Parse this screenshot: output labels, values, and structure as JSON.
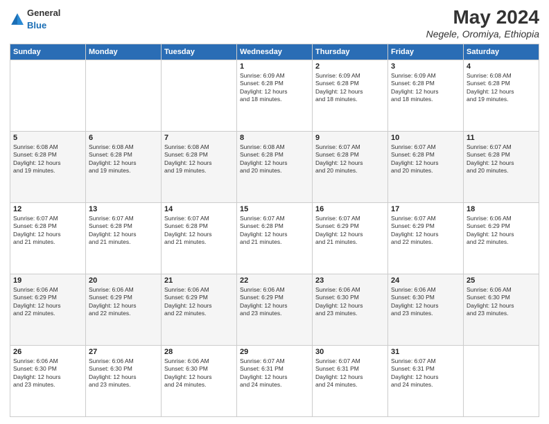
{
  "header": {
    "logo_general": "General",
    "logo_blue": "Blue",
    "month_year": "May 2024",
    "location": "Negele, Oromiya, Ethiopia"
  },
  "weekdays": [
    "Sunday",
    "Monday",
    "Tuesday",
    "Wednesday",
    "Thursday",
    "Friday",
    "Saturday"
  ],
  "weeks": [
    [
      {
        "day": "",
        "info": ""
      },
      {
        "day": "",
        "info": ""
      },
      {
        "day": "",
        "info": ""
      },
      {
        "day": "1",
        "info": "Sunrise: 6:09 AM\nSunset: 6:28 PM\nDaylight: 12 hours\nand 18 minutes."
      },
      {
        "day": "2",
        "info": "Sunrise: 6:09 AM\nSunset: 6:28 PM\nDaylight: 12 hours\nand 18 minutes."
      },
      {
        "day": "3",
        "info": "Sunrise: 6:09 AM\nSunset: 6:28 PM\nDaylight: 12 hours\nand 18 minutes."
      },
      {
        "day": "4",
        "info": "Sunrise: 6:08 AM\nSunset: 6:28 PM\nDaylight: 12 hours\nand 19 minutes."
      }
    ],
    [
      {
        "day": "5",
        "info": "Sunrise: 6:08 AM\nSunset: 6:28 PM\nDaylight: 12 hours\nand 19 minutes."
      },
      {
        "day": "6",
        "info": "Sunrise: 6:08 AM\nSunset: 6:28 PM\nDaylight: 12 hours\nand 19 minutes."
      },
      {
        "day": "7",
        "info": "Sunrise: 6:08 AM\nSunset: 6:28 PM\nDaylight: 12 hours\nand 19 minutes."
      },
      {
        "day": "8",
        "info": "Sunrise: 6:08 AM\nSunset: 6:28 PM\nDaylight: 12 hours\nand 20 minutes."
      },
      {
        "day": "9",
        "info": "Sunrise: 6:07 AM\nSunset: 6:28 PM\nDaylight: 12 hours\nand 20 minutes."
      },
      {
        "day": "10",
        "info": "Sunrise: 6:07 AM\nSunset: 6:28 PM\nDaylight: 12 hours\nand 20 minutes."
      },
      {
        "day": "11",
        "info": "Sunrise: 6:07 AM\nSunset: 6:28 PM\nDaylight: 12 hours\nand 20 minutes."
      }
    ],
    [
      {
        "day": "12",
        "info": "Sunrise: 6:07 AM\nSunset: 6:28 PM\nDaylight: 12 hours\nand 21 minutes."
      },
      {
        "day": "13",
        "info": "Sunrise: 6:07 AM\nSunset: 6:28 PM\nDaylight: 12 hours\nand 21 minutes."
      },
      {
        "day": "14",
        "info": "Sunrise: 6:07 AM\nSunset: 6:28 PM\nDaylight: 12 hours\nand 21 minutes."
      },
      {
        "day": "15",
        "info": "Sunrise: 6:07 AM\nSunset: 6:28 PM\nDaylight: 12 hours\nand 21 minutes."
      },
      {
        "day": "16",
        "info": "Sunrise: 6:07 AM\nSunset: 6:29 PM\nDaylight: 12 hours\nand 21 minutes."
      },
      {
        "day": "17",
        "info": "Sunrise: 6:07 AM\nSunset: 6:29 PM\nDaylight: 12 hours\nand 22 minutes."
      },
      {
        "day": "18",
        "info": "Sunrise: 6:06 AM\nSunset: 6:29 PM\nDaylight: 12 hours\nand 22 minutes."
      }
    ],
    [
      {
        "day": "19",
        "info": "Sunrise: 6:06 AM\nSunset: 6:29 PM\nDaylight: 12 hours\nand 22 minutes."
      },
      {
        "day": "20",
        "info": "Sunrise: 6:06 AM\nSunset: 6:29 PM\nDaylight: 12 hours\nand 22 minutes."
      },
      {
        "day": "21",
        "info": "Sunrise: 6:06 AM\nSunset: 6:29 PM\nDaylight: 12 hours\nand 22 minutes."
      },
      {
        "day": "22",
        "info": "Sunrise: 6:06 AM\nSunset: 6:29 PM\nDaylight: 12 hours\nand 23 minutes."
      },
      {
        "day": "23",
        "info": "Sunrise: 6:06 AM\nSunset: 6:30 PM\nDaylight: 12 hours\nand 23 minutes."
      },
      {
        "day": "24",
        "info": "Sunrise: 6:06 AM\nSunset: 6:30 PM\nDaylight: 12 hours\nand 23 minutes."
      },
      {
        "day": "25",
        "info": "Sunrise: 6:06 AM\nSunset: 6:30 PM\nDaylight: 12 hours\nand 23 minutes."
      }
    ],
    [
      {
        "day": "26",
        "info": "Sunrise: 6:06 AM\nSunset: 6:30 PM\nDaylight: 12 hours\nand 23 minutes."
      },
      {
        "day": "27",
        "info": "Sunrise: 6:06 AM\nSunset: 6:30 PM\nDaylight: 12 hours\nand 23 minutes."
      },
      {
        "day": "28",
        "info": "Sunrise: 6:06 AM\nSunset: 6:30 PM\nDaylight: 12 hours\nand 24 minutes."
      },
      {
        "day": "29",
        "info": "Sunrise: 6:07 AM\nSunset: 6:31 PM\nDaylight: 12 hours\nand 24 minutes."
      },
      {
        "day": "30",
        "info": "Sunrise: 6:07 AM\nSunset: 6:31 PM\nDaylight: 12 hours\nand 24 minutes."
      },
      {
        "day": "31",
        "info": "Sunrise: 6:07 AM\nSunset: 6:31 PM\nDaylight: 12 hours\nand 24 minutes."
      },
      {
        "day": "",
        "info": ""
      }
    ]
  ]
}
